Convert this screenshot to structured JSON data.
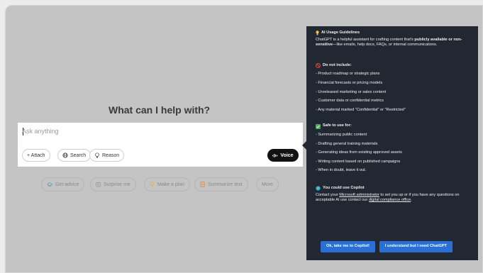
{
  "main": {
    "heading": "What can I help with?",
    "prompt_placeholder": "Ask anything",
    "tools": {
      "attach": "+ Attach",
      "search": "Search",
      "reason": "Reason",
      "voice": "Voice"
    },
    "suggestions": [
      "Get advice",
      "Surprise me",
      "Make a plan",
      "Summarize text",
      "More"
    ]
  },
  "panel": {
    "title": "AI Usage Guidelines",
    "intro_a": "ChatGPT is a helpful assistant for crafting content that's ",
    "intro_b": "publicly available or non-sensitive",
    "intro_c": "—like emails, help docs, FAQs, or internal communications.",
    "exclude_title": "Do not include:",
    "exclude_items": [
      "- Product roadmap or strategic plans",
      "- Financial forecasts or pricing models",
      "- Unreleased marketing or sales content",
      "- Customer data or confidential metrics",
      "- Any material marked \"Confidential\" or \"Restricted\""
    ],
    "safe_title": "Safe to use for:",
    "safe_items": [
      "- Summarizing public content",
      "- Drafting general training materials",
      "- Generating ideas from existing approved assets",
      "- Writing content based on published campaigns",
      "- When in doubt, leave it out."
    ],
    "copilot_title": "You could use Copilot",
    "copilot_a": "Contact your ",
    "copilot_link1": "Microsoft administrator",
    "copilot_b": " to set you up or if you have any questions on acceptable AI use contact our ",
    "copilot_link2": "digital compliance office",
    "copilot_c": ".",
    "btn_copilot": "Ok, take me to Copilot!",
    "btn_chatgpt": "I understand but I need ChatGPT"
  }
}
